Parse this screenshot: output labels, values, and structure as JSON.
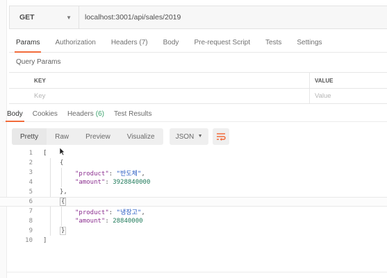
{
  "request": {
    "method": "GET",
    "url": "localhost:3001/api/sales/2019"
  },
  "request_tabs": [
    {
      "label": "Params",
      "active": true
    },
    {
      "label": "Authorization",
      "active": false
    },
    {
      "label": "Headers (7)",
      "active": false
    },
    {
      "label": "Body",
      "active": false
    },
    {
      "label": "Pre-request Script",
      "active": false
    },
    {
      "label": "Tests",
      "active": false
    },
    {
      "label": "Settings",
      "active": false
    }
  ],
  "query_params": {
    "title": "Query Params",
    "col_key": "KEY",
    "col_value": "VALUE",
    "key_placeholder": "Key",
    "value_placeholder": "Value"
  },
  "response_tabs": {
    "body": "Body",
    "cookies": "Cookies",
    "headers": "Headers",
    "headers_count": "(6)",
    "test_results": "Test Results"
  },
  "toolbar": {
    "pretty": "Pretty",
    "raw": "Raw",
    "preview": "Preview",
    "visualize": "Visualize",
    "format": "JSON"
  },
  "code_lines": [
    {
      "n": "1",
      "text": "["
    },
    {
      "n": "2",
      "text": "{"
    },
    {
      "n": "3",
      "key": "\"product\"",
      "str": "\"반도체\""
    },
    {
      "n": "4",
      "key": "\"amount\"",
      "num": "3928840000"
    },
    {
      "n": "5",
      "text": "},"
    },
    {
      "n": "6",
      "text": "{"
    },
    {
      "n": "7",
      "key": "\"product\"",
      "str": "\"냉장고\""
    },
    {
      "n": "8",
      "key": "\"amount\"",
      "num": "28840000"
    },
    {
      "n": "9",
      "text": "}"
    },
    {
      "n": "10",
      "text": "]"
    }
  ],
  "colors": {
    "accent": "#f26b3a",
    "count": "#3aa36d",
    "json_key": "#8b2e8f",
    "json_string": "#2458c2",
    "json_number": "#1f7a5a"
  }
}
